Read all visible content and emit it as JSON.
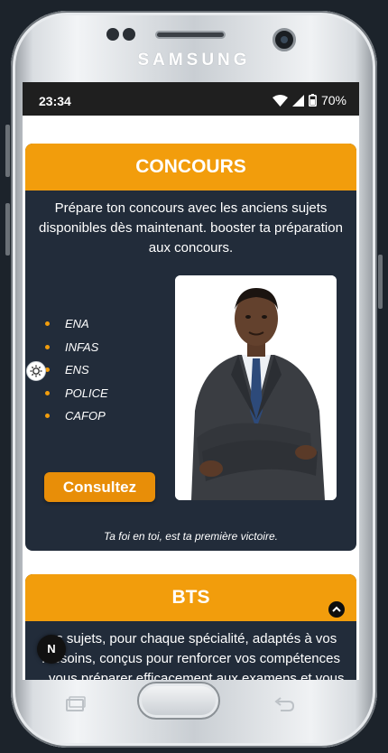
{
  "device": {
    "brand": "SAMSUNG"
  },
  "status_bar": {
    "time": "23:34",
    "battery": "70%"
  },
  "concours_card": {
    "title": "CONCOURS",
    "description": "Prépare ton concours avec les anciens sujets disponibles dès maintenant. booster ta préparation aux concours.",
    "items": [
      "ENA",
      "INFAS",
      "ENS",
      "POLICE",
      "CAFOP"
    ],
    "button_label": "Consultez",
    "motto": "Ta foi en toi, est ta première victoire."
  },
  "bts_card": {
    "title": "BTS",
    "description": "...s sujets, pour chaque spécialité, adaptés à vos ...esoins, conçus pour renforcer vos compétences ...vous préparer efficacement aux examens et vous"
  },
  "floating": {
    "n_badge": "N"
  },
  "colors": {
    "accent": "#f29d0c",
    "card_bg": "#222c3a",
    "button": "#e88e08"
  }
}
